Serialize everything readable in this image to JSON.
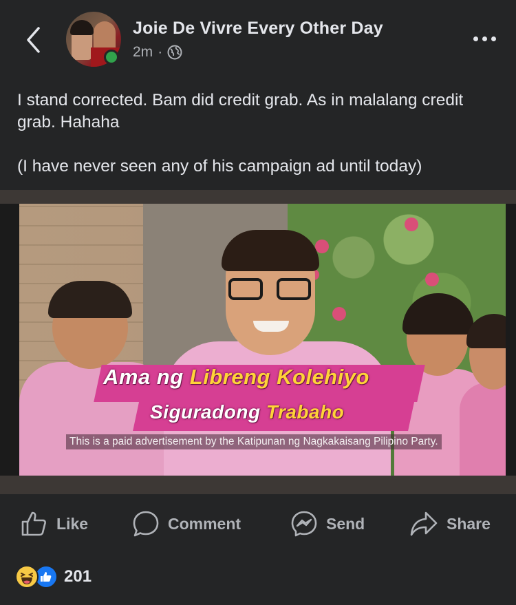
{
  "post": {
    "author": "Joie De Vivre Every Other Day",
    "time": "2m",
    "separator": "·",
    "audience_icon": "globe-icon",
    "text_line1": "I stand corrected. Bam did credit grab. As in malalang credit grab. Hahaha",
    "text_line2": "(I have never seen any of his campaign ad until today)"
  },
  "media": {
    "caption_white_1": "Ama ng ",
    "caption_yellow_1": "Libreng Kolehiyo",
    "caption_white_2": "Siguradong ",
    "caption_yellow_2": "Trabaho",
    "disclaimer": "This is a paid advertisement by the Katipunan ng Nagkakaisang Pilipino Party.",
    "caption_band_color": "#d63f93",
    "caption_yellow_color": "#ffd338"
  },
  "actions": {
    "like": "Like",
    "comment": "Comment",
    "send": "Send",
    "share": "Share"
  },
  "reactions": {
    "count": "201",
    "types": [
      "haha-icon",
      "like-icon"
    ]
  },
  "colors": {
    "background": "#242526",
    "text_primary": "#e4e6eb",
    "text_secondary": "#b0b3b8",
    "online": "#31a24c",
    "like_blue": "#1877f2"
  }
}
